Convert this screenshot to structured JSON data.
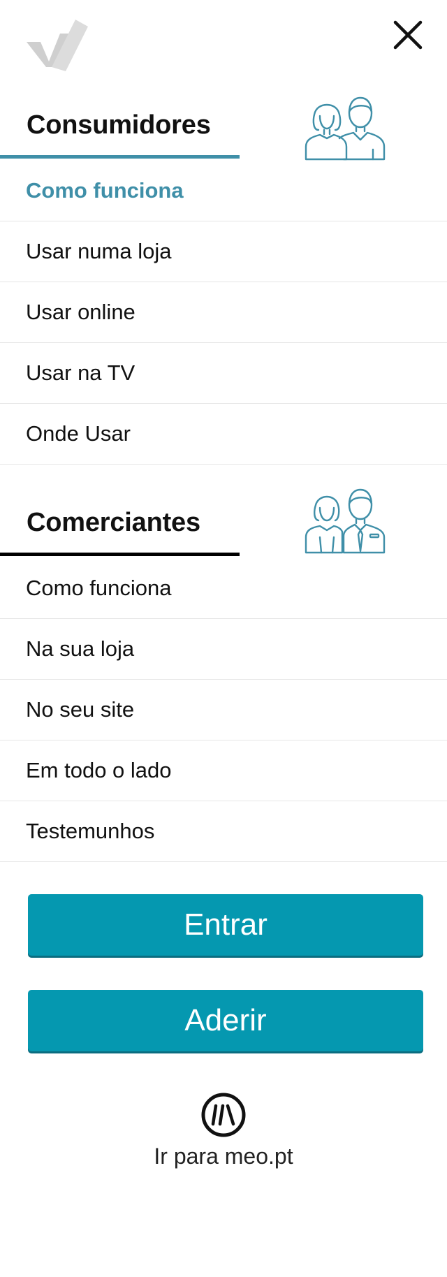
{
  "colors": {
    "accent": "#0598b0",
    "accent_text": "#3f8fa8",
    "active_underline": "#3f8fa8",
    "inactive_underline": "#000000",
    "logo_gray": "#cfcfcf",
    "divider": "#e6e6e6"
  },
  "header": {
    "logo_icon": "wallet-check-logo-icon",
    "close_icon": "close-icon"
  },
  "consumers": {
    "title": "Consumidores",
    "icon": "consumers-people-icon",
    "items": [
      {
        "label": "Como funciona",
        "active": true
      },
      {
        "label": "Usar numa loja",
        "active": false
      },
      {
        "label": "Usar online",
        "active": false
      },
      {
        "label": "Usar na TV",
        "active": false
      },
      {
        "label": "Onde Usar",
        "active": false
      }
    ]
  },
  "merchants": {
    "title": "Comerciantes",
    "icon": "merchants-people-icon",
    "items": [
      {
        "label": "Como funciona",
        "active": false
      },
      {
        "label": "Na sua loja",
        "active": false
      },
      {
        "label": "No seu site",
        "active": false
      },
      {
        "label": "Em todo o lado",
        "active": false
      },
      {
        "label": "Testemunhos",
        "active": false
      }
    ]
  },
  "actions": {
    "login_label": "Entrar",
    "join_label": "Aderir"
  },
  "footer": {
    "meo_icon": "meo-logo-icon",
    "meo_link_label": "Ir para meo.pt"
  }
}
